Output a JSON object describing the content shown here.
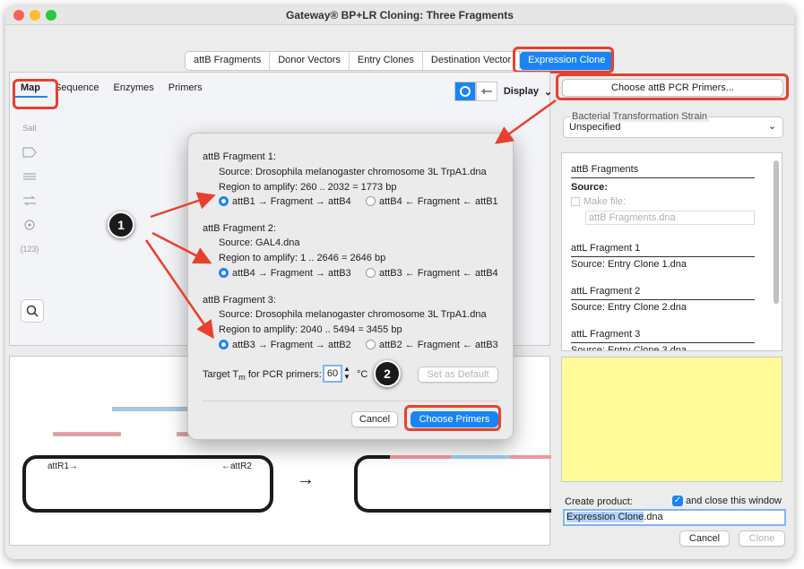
{
  "window": {
    "title": "Gateway® BP+LR Cloning: Three Fragments"
  },
  "tabs": [
    "attB Fragments",
    "Donor Vectors",
    "Entry Clones",
    "Destination Vector",
    "Expression Clone"
  ],
  "subtabs": [
    "Map",
    "Sequence",
    "Enzymes",
    "Primers"
  ],
  "toolbar": {
    "display_label": "Display",
    "tool_labels": [
      "SalI",
      "{123}"
    ]
  },
  "right": {
    "choose_primers_label": "Choose attB PCR Primers...",
    "strain_label": "Bacterial Transformation Strain",
    "strain_value": "Unspecified",
    "list": {
      "header": "attB Fragments",
      "source_label": "Source:",
      "make_file_label": "Make file:",
      "make_file_value": "attB Fragments.dna",
      "items": [
        {
          "title": "attL Fragment 1",
          "source": "Source:  Entry Clone 1.dna"
        },
        {
          "title": "attL Fragment 2",
          "source": "Source:  Entry Clone 2.dna"
        },
        {
          "title": "attL Fragment 3",
          "source": "Source:  Entry Clone 3.dna"
        }
      ]
    },
    "create_product_label": "Create product:",
    "close_window_label": "and close this window",
    "product_name_highlight": "Expression Clone",
    "product_name_ext": ".dna",
    "cancel_label": "Cancel",
    "clone_label": "Clone"
  },
  "map": {
    "att_left": "attR1→",
    "att_right": "←attR2"
  },
  "dialog": {
    "fragments": [
      {
        "title": "attB Fragment 1:",
        "source": "Source:  Drosophila melanogaster chromosome 3L TrpA1.dna",
        "region": "Region to amplify:  260 .. 2032  =  1773 bp",
        "opt1": "attB1 → Fragment → attB4",
        "opt2": "attB4 ← Fragment ← attB1"
      },
      {
        "title": "attB Fragment 2:",
        "source": "Source:  GAL4.dna",
        "region": "Region to amplify:  1 .. 2646  =  2646 bp",
        "opt1": "attB4 → Fragment → attB3",
        "opt2": "attB3 ← Fragment ← attB4"
      },
      {
        "title": "attB Fragment 3:",
        "source": "Source:  Drosophila melanogaster chromosome 3L TrpA1.dna",
        "region": "Region to amplify:  2040 .. 5494  =  3455 bp",
        "opt1": "attB3 → Fragment → attB2",
        "opt2": "attB2 ← Fragment ← attB3"
      }
    ],
    "tm_label": "Target T",
    "tm_sub": "m",
    "tm_label_rest": " for PCR primers:",
    "tm_value": "60",
    "tm_unit": "°C",
    "set_default_label": "Set as Default",
    "cancel_label": "Cancel",
    "choose_label": "Choose Primers"
  },
  "callouts": [
    "1",
    "2"
  ],
  "colors": {
    "accent": "#1a84f4",
    "highlight": "#e8402e",
    "pink": "#f2969c",
    "blue": "#9ccdf0",
    "yellow": "#fffb99"
  }
}
